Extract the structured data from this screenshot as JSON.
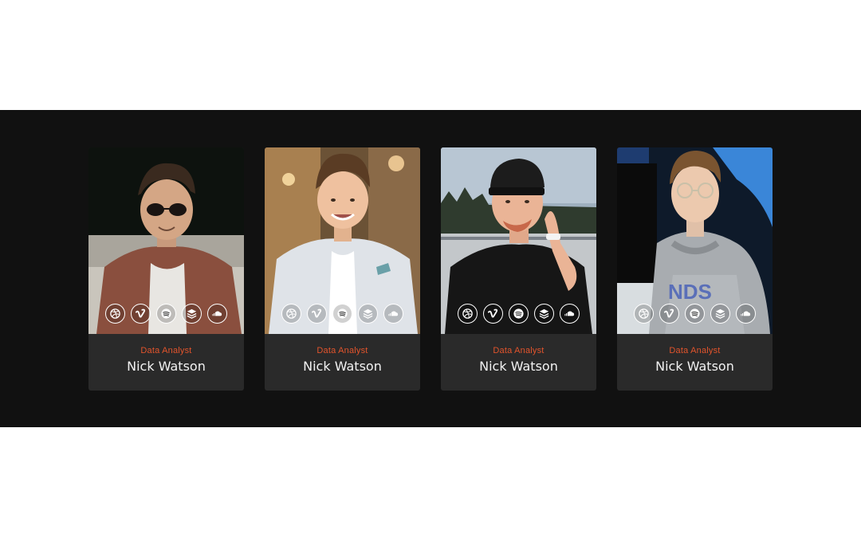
{
  "team": {
    "members": [
      {
        "role": "Data Analyst",
        "name": "Nick Watson",
        "photo_icon": "person-sunglasses-portrait-icon",
        "socials": [
          "dribbble-icon",
          "vimeo-icon",
          "spotify-icon",
          "buffer-icon",
          "soundcloud-icon"
        ]
      },
      {
        "role": "Data Analyst",
        "name": "Nick Watson",
        "photo_icon": "person-white-blazer-portrait-icon",
        "socials": [
          "dribbble-icon",
          "vimeo-icon",
          "spotify-icon",
          "buffer-icon",
          "soundcloud-icon"
        ]
      },
      {
        "role": "Data Analyst",
        "name": "Nick Watson",
        "photo_icon": "person-backwards-cap-portrait-icon",
        "socials": [
          "dribbble-icon",
          "vimeo-icon",
          "spotify-icon",
          "buffer-icon",
          "soundcloud-icon"
        ]
      },
      {
        "role": "Data Analyst",
        "name": "Nick Watson",
        "photo_icon": "person-glasses-hoodie-portrait-icon",
        "socials": [
          "dribbble-icon",
          "vimeo-icon",
          "spotify-icon",
          "buffer-icon",
          "soundcloud-icon"
        ]
      }
    ]
  },
  "colors": {
    "band_background": "#111111",
    "card_background": "#2a2a2a",
    "role_accent": "#e2542c",
    "name_text": "#f2f2f2"
  }
}
